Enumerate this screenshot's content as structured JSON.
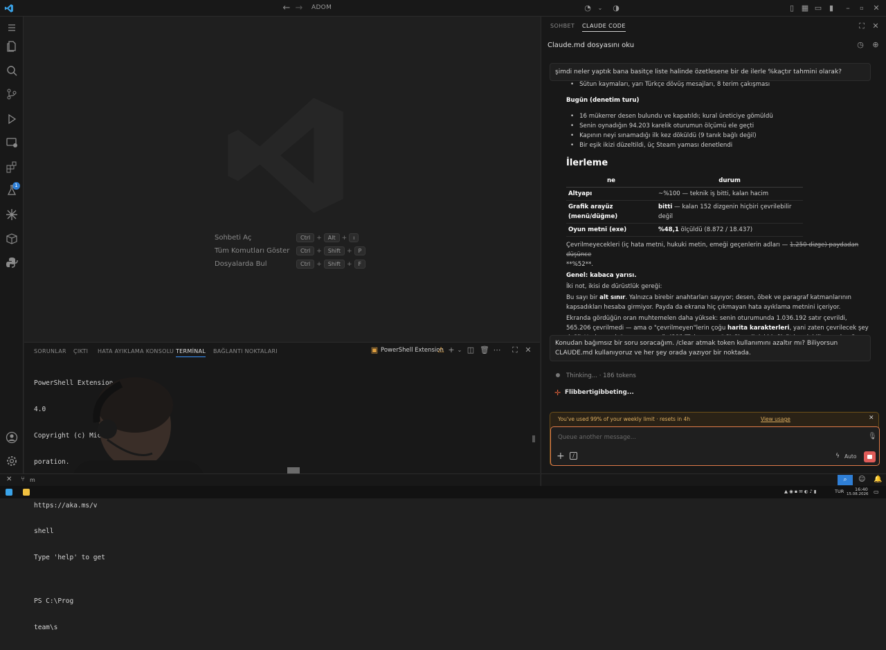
{
  "titlebar": {
    "project": "ADOM"
  },
  "activitybar": {
    "extensions_badge": "1"
  },
  "welcome": {
    "shortcuts": [
      {
        "label": "Sohbeti Aç",
        "keys": [
          "Ctrl",
          "Alt",
          "ı"
        ]
      },
      {
        "label": "Tüm Komutları Göster",
        "keys": [
          "Ctrl",
          "Shift",
          "P"
        ]
      },
      {
        "label": "Dosyalarda Bul",
        "keys": [
          "Ctrl",
          "Shift",
          "F"
        ]
      }
    ]
  },
  "panel": {
    "tabs": [
      "SORUNLAR",
      "ÇIKTI",
      "HATA AYIKLAMA KONSOLU",
      "TERMİNAL",
      "BAĞLANTI NOKTALARI"
    ],
    "active_tab": "TERMİNAL",
    "shell_label": "PowerShell Extension",
    "terminal_lines": [
      "PowerShell Extension v2025",
      "4.0",
      "Copyright (c) Micr",
      "poration.",
      "",
      "https://aka.ms/v",
      "shell",
      "Type 'help' to get",
      "",
      "PS C:\\Prog",
      "team\\s"
    ]
  },
  "statusbar": {
    "branch": "m"
  },
  "chat": {
    "tabs": [
      "SOHBET",
      "CLAUDE CODE"
    ],
    "active_tab": "CLAUDE CODE",
    "title": "Claude.md dosyasını oku",
    "user_message_1": "şimdi neler yaptık bana basitçe liste halinde özetlesene bir de ilerle %kaçtır tahmini olarak?",
    "prev_bullet": "Sütun kaymaları, yarı Türkçe dövüş mesajları, 8 terim çakışması",
    "today_heading": "Bugün (denetim turu)",
    "today_bullets": [
      "16 mükerrer desen bulundu ve kapatıldı; kural üreticiye gömüldü",
      "Senin oynadığın 94.203 karelik oturumun ölçümü ele geçti",
      "Kapının neyi sınamadığı ilk kez döküldü (9 tanık bağlı değil)",
      "Bir eşik ikizi düzeltildi, üç Steam yaması denetlendi"
    ],
    "progress_heading": "İlerleme",
    "table": {
      "headers": [
        "ne",
        "durum"
      ],
      "rows": [
        {
          "k": "Altyapı",
          "v": "~%100 — teknik iş bitti, kalan hacim"
        },
        {
          "k": "Grafik arayüz (menü/düğme)",
          "v_bold": "bitti",
          "v": " — kalan 152 dizgenin hiçbiri çevrilebilir değil"
        },
        {
          "k": "Oyun metni (exe)",
          "v_bold": "%48,1",
          "v": " ölçüldü (8.872 / 18.437)"
        }
      ]
    },
    "untranslatable_pre": "Çevrilmeyecekleri (iç hata metni, hukuki metin, emeği geçenlerin adları — ",
    "untranslatable_strike": "1.250 dizge) paydadan düşünce",
    "untranslatable_post": "**%52**.",
    "general_heading": "Genel: kabaca yarısı.",
    "two_notes": "İki not, ikisi de dürüstlük gereği:",
    "note1_pre": "Bu sayı bir ",
    "note1_bold": "alt sınır",
    "note1_post": ". Yalnızca birebir anahtarları sayıyor; desen, öbek ve paragraf katmanlarının kapsadıkları hesaba girmiyor. Payda da ekrana hiç çıkmayan hata ayıklama metnini içeriyor.",
    "note2_pre": "Ekranda gördüğün oran muhtemelen daha yüksek: senin oturumunda 1.036.192 satır çevrildi, 565.206 çevrilmedi — ama o \"çevrilmeyen\"lerin çoğu ",
    "note2_bold": "harita karakterleri",
    "note2_post": ", yani zaten çevrilecek şey değil. Yani gerçek \"oyuncunun gördüğü Türkçe oranı\" ölçülmedi; iyi bir ölçüt kurulabilir ama henüz yok.",
    "user_message_2": "Konudan bağımsız bir soru soracağım. /clear atmak token kullanımını azaltır mı? Biliyorsun CLAUDE.md kullanıyoruz ve her şey orada yazıyor bir noktada.",
    "thinking": "Thinking... · 186 tokens",
    "working": "Flibbertigibbeting...",
    "limit_text": "You've used 99% of your weekly limit · resets in 4h",
    "view_usage": "View usage",
    "input_placeholder": "Queue another message...",
    "mode_label": "Auto"
  },
  "tray": {
    "lang": "TUR",
    "time": "16:40",
    "date": "15.08.2026"
  },
  "colors": {
    "accent": "#3794ff",
    "limit_warn": "#e0b060",
    "input_border": "#e07b49",
    "stop": "#e05c59"
  }
}
